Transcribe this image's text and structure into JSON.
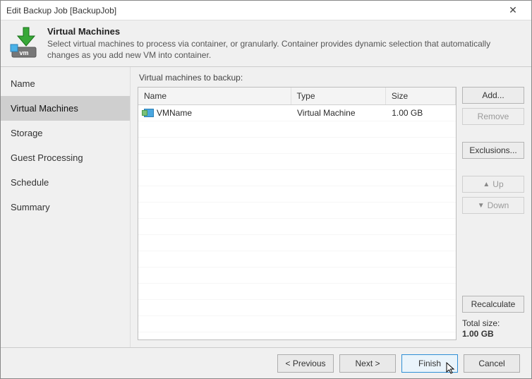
{
  "window": {
    "title": "Edit Backup Job [BackupJob]"
  },
  "header": {
    "title": "Virtual Machines",
    "description": "Select virtual machines to process via container, or granularly. Container provides dynamic selection that automatically changes as you add new VM into container."
  },
  "nav": {
    "items": [
      {
        "label": "Name"
      },
      {
        "label": "Virtual Machines"
      },
      {
        "label": "Storage"
      },
      {
        "label": "Guest Processing"
      },
      {
        "label": "Schedule"
      },
      {
        "label": "Summary"
      }
    ],
    "selected": 1
  },
  "main": {
    "list_label": "Virtual machines to backup:",
    "columns": {
      "name": "Name",
      "type": "Type",
      "size": "Size"
    },
    "rows": [
      {
        "name": "VMName",
        "type": "Virtual Machine",
        "size": "1.00 GB"
      }
    ],
    "side": {
      "add": "Add...",
      "remove": "Remove",
      "exclusions": "Exclusions...",
      "up": "Up",
      "down": "Down",
      "recalculate": "Recalculate",
      "total_label": "Total size:",
      "total_value": "1.00 GB"
    }
  },
  "footer": {
    "previous": "< Previous",
    "next": "Next >",
    "finish": "Finish",
    "cancel": "Cancel"
  }
}
